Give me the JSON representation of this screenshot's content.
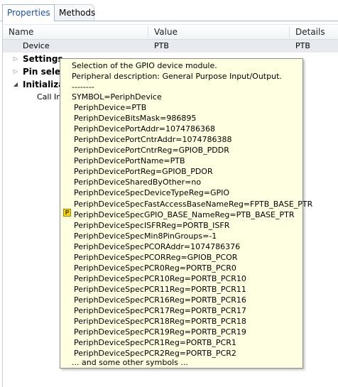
{
  "tabs": {
    "properties": "Properties",
    "methods": "Methods"
  },
  "columns": {
    "name": "Name",
    "value": "Value",
    "details": "Details"
  },
  "rows": {
    "device": {
      "name": "Device",
      "value": "PTB",
      "details": "PTB"
    },
    "settings": "Settings",
    "pin_select": "Pin select",
    "initialization": "Initializat",
    "call_init": "Call In"
  },
  "tooltip": {
    "header1": "Selection of the GPIO device module.",
    "header2": "Peripheral description: General Purpose Input/Output.",
    "sep": "--------",
    "symbol": "SYMBOL=PeriphDevice",
    "lines": [
      "PeriphDevice=PTB",
      "PeriphDeviceBitsMask=986895",
      "PeriphDevicePortAddr=1074786368",
      "PeriphDevicePortCntrAddr=1074786388",
      "PeriphDevicePortCntrReg=GPIOB_PDDR",
      "PeriphDevicePortName=PTB",
      "PeriphDevicePortReg=GPIOB_PDOR",
      "PeriphDeviceSharedByOther=no",
      "PeriphDeviceSpecDeviceTypeReg=GPIO",
      "PeriphDeviceSpecFastAccessBaseNameReg=FPTB_BASE_PTR",
      "PeriphDeviceSpecGPIO_BASE_NameReg=PTB_BASE_PTR",
      "PeriphDeviceSpecISFRReg=PORTB_ISFR",
      "PeriphDeviceSpecMin8PinGroups=-1",
      "PeriphDeviceSpecPCORAddr=1074786376",
      "PeriphDeviceSpecPCORReg=GPIOB_PCOR",
      "PeriphDeviceSpecPCR0Reg=PORTB_PCR0",
      "PeriphDeviceSpecPCR10Reg=PORTB_PCR10",
      "PeriphDeviceSpecPCR11Reg=PORTB_PCR11",
      "PeriphDeviceSpecPCR16Reg=PORTB_PCR16",
      "PeriphDeviceSpecPCR17Reg=PORTB_PCR17",
      "PeriphDeviceSpecPCR18Reg=PORTB_PCR18",
      "PeriphDeviceSpecPCR19Reg=PORTB_PCR19",
      "PeriphDeviceSpecPCR1Reg=PORTB_PCR1",
      "PeriphDeviceSpecPCR2Reg=PORTB_PCR2"
    ],
    "footer": "... and some other symbols ...",
    "icon_letter": "P"
  }
}
